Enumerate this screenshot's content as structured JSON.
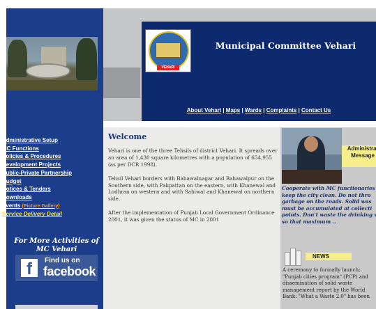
{
  "header": {
    "title": "Municipal Committee Vehari",
    "logo_text": "VEHARI",
    "nav": [
      "About Vehari",
      "Maps",
      "Wards",
      "Complaints",
      "Contact Us"
    ]
  },
  "sidebar": {
    "items": [
      {
        "label": "Administrative Setup"
      },
      {
        "label": "MC Functions"
      },
      {
        "label": "Policies & Procedures"
      },
      {
        "label": "Development Projects"
      },
      {
        "label": "Public-Private Partnership"
      },
      {
        "label": "Budget"
      },
      {
        "label": "Notices & Tenders"
      },
      {
        "label": "Downloads"
      },
      {
        "label": "Events",
        "extra": "(Picture Gallery)"
      },
      {
        "label": "Service Delivery Detail"
      }
    ],
    "more_activities": "For More Activities of MC Vehari",
    "facebook": {
      "find_us": "Find us on",
      "brand": "facebook",
      "icon": "facebook-f-icon",
      "color": "#3b5998"
    }
  },
  "main": {
    "heading": "Welcome",
    "paragraphs": [
      "Vehari is one of the three Tehsils of district Vehari. It spreads over an area of 1,430 square kilometres with a population of 654,955 (as per DCR 1998).",
      "Tehsil Vehari borders with Bahawalnagar and Bahawalpur on the Southern side, with Pakpattan on the eastern, with Khanewal and Lodhran on western and with Sahiwal and Khanewal on northern side.",
      "After the implementation of Punjab Local Government Ordinance 2001, it was given the status of MC in 2001"
    ]
  },
  "right": {
    "admin_label": [
      "Administrat",
      "Message"
    ],
    "quote_lines": [
      "Cooperate with MC functionaries",
      "keep the city clean. Do not thro",
      "garbage on the roads. Solid was",
      "must be accumulated at collecti",
      "points. Don't waste the drinking wat",
      "so that maximum .."
    ],
    "news_label": "NEWS",
    "news_lines": [
      "A ceremony to formally launch;",
      "\"Punjab cities program\" (PCP) and",
      "dissemination of solid waste",
      "management report by the World",
      "Bank: \"What a Waste 2.0\" has been"
    ]
  },
  "colors": {
    "sidebar_bg": "#1c3e8a",
    "header_bg": "#0e2a6e",
    "highlight": "#f6ee8a",
    "events_extra": "#f59a2a",
    "service_delivery": "#f7e24a"
  }
}
